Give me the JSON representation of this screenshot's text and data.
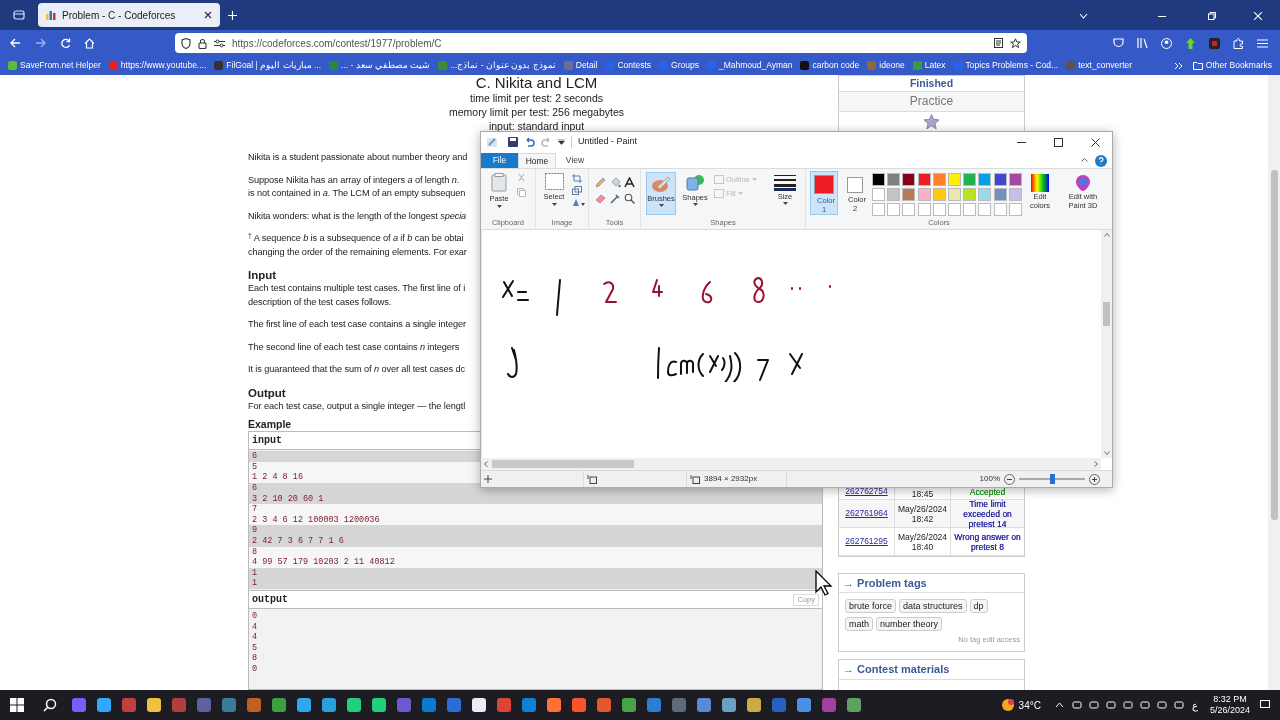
{
  "browser": {
    "tab": {
      "title": "Problem - C - Codeforces",
      "selected": true
    },
    "url": "https://codeforces.com/contest/1977/problem/C",
    "bookmarks": [
      {
        "label": "SaveFrom.net Helper"
      },
      {
        "label": "https://www.youtube...."
      },
      {
        "label": "FilGoal | مباريات اليوم ..."
      },
      {
        "label": "شيت مصطفي سعد - ..."
      },
      {
        "label": "نموذج بدون عنوان - نماذج..."
      },
      {
        "label": "Detail"
      },
      {
        "label": "Contests"
      },
      {
        "label": "Groups"
      },
      {
        "label": "_Mahmoud_Ayman"
      },
      {
        "label": "carbon code"
      },
      {
        "label": "ideone"
      },
      {
        "label": "Latex"
      },
      {
        "label": "Topics Problems - Cod..."
      },
      {
        "label": "text_converter"
      }
    ],
    "other_bookmarks": "Other Bookmarks"
  },
  "problem": {
    "title": "C. Nikita and LCM",
    "limits": [
      "time limit per test: 2 seconds",
      "memory limit per test: 256 megabytes",
      "input: standard input"
    ],
    "blocks": [
      {
        "kind": "text",
        "lines": [
          "Nikita is a student passionate about number theory and"
        ]
      },
      {
        "kind": "text",
        "lines": [
          "Suppose Nikita has an array of integers *a* of length *n*.",
          "is not contained in *a*. The LCM of an empty subsequen"
        ]
      },
      {
        "kind": "text",
        "lines": [
          "Nikita wonders: what is the length of the longest *specia*"
        ]
      },
      {
        "kind": "text",
        "lines": [
          "$^{†}$ A sequence *b* is a subsequence of *a* if *b* can be obtai",
          "changing the order of the remaining elements. For exar"
        ]
      },
      {
        "kind": "heading",
        "text": "Input"
      },
      {
        "kind": "text",
        "lines": [
          "Each test contains multiple test cases. The first line of i",
          "description of the test cases follows."
        ]
      },
      {
        "kind": "text",
        "lines": [
          "The first line of each test case contains a single integer"
        ]
      },
      {
        "kind": "text",
        "lines": [
          "The second line of each test case contains *n* integers"
        ]
      },
      {
        "kind": "text",
        "lines": [
          "It is guaranteed that the sum of *n* over all test cases dc"
        ]
      },
      {
        "kind": "heading",
        "text": "Output"
      },
      {
        "kind": "text",
        "lines": [
          "For each test case, output a single integer — the lengtl"
        ]
      }
    ]
  },
  "example": {
    "title": "Example",
    "input_label": "input",
    "input_lines": [
      {
        "text": "6",
        "highlighted": true
      },
      {
        "text": "5",
        "highlighted": false
      },
      {
        "text": "1 2 4 8 16",
        "highlighted": false
      },
      {
        "text": "6",
        "highlighted": true
      },
      {
        "text": "3 2 10 20 60 1",
        "highlighted": true
      },
      {
        "text": "7",
        "highlighted": false
      },
      {
        "text": "2 3 4 6 12 100003 1200036",
        "highlighted": false
      },
      {
        "text": "9",
        "highlighted": true
      },
      {
        "text": "2 42 7 3 6 7 7 1 6",
        "highlighted": true
      },
      {
        "text": "8",
        "highlighted": false
      },
      {
        "text": "4 99 57 179 10203 2 11 40812",
        "highlighted": false
      },
      {
        "text": "1",
        "highlighted": true
      },
      {
        "text": "1",
        "highlighted": true
      }
    ],
    "output_label": "output",
    "copy": "Copy",
    "output_lines": [
      "0",
      "4",
      "4",
      "5",
      "8",
      "0"
    ]
  },
  "sidebar": {
    "status": "Finished",
    "practice": "Practice",
    "submissions": [
      {
        "id": "262762754",
        "when": "18:45",
        "verdict": "Accepted",
        "color": "#1f9a1f"
      },
      {
        "id": "262761964",
        "when": "May/26/2024 18:42",
        "verdict": "Time limit exceeded on pretest 14",
        "color": "#2a2aa0"
      },
      {
        "id": "262761295",
        "when": "May/26/2024 18:40",
        "verdict": "Wrong answer on pretest 8",
        "color": "#2a2aa0"
      }
    ],
    "tags_title": "→ Problem tags",
    "tags": [
      "brute force",
      "data structures",
      "dp",
      "math",
      "number theory"
    ],
    "tags_note": "No tag edit access",
    "materials_title": "→ Contest materials"
  },
  "paint": {
    "title": "Untitled - Paint",
    "tabs": [
      {
        "label": "File",
        "kind": "file",
        "selected": false
      },
      {
        "label": "Home",
        "kind": "tab",
        "selected": true
      },
      {
        "label": "View",
        "kind": "tab",
        "selected": false
      }
    ],
    "ribbon": {
      "paste": "Paste",
      "select": "Select",
      "brushes": {
        "label": "Brushes",
        "selected": true
      },
      "shapes": "Shapes",
      "outline": {
        "label": "Outline",
        "disabled": true
      },
      "fill": {
        "label": "Fill",
        "disabled": true
      },
      "size": "Size",
      "color1": {
        "label": "Color 1",
        "selected": true,
        "color": "#ed1c24"
      },
      "color2": {
        "label": "Color 2",
        "selected": false,
        "color": "#ffffff"
      },
      "edit_colors": "Edit colors",
      "paint3d": "Edit with Paint 3D",
      "groups": [
        "Clipboard",
        "Image",
        "Tools",
        "Shapes",
        "Colors"
      ]
    },
    "palette": [
      {
        "color": "#000000"
      },
      {
        "color": "#7f7f7f"
      },
      {
        "color": "#880015"
      },
      {
        "color": "#ed1c24"
      },
      {
        "color": "#ff7f27"
      },
      {
        "color": "#fff200"
      },
      {
        "color": "#22b14c"
      },
      {
        "color": "#00a2e8"
      },
      {
        "color": "#3f48cc"
      },
      {
        "color": "#a349a4"
      },
      {
        "color": "#ffffff"
      },
      {
        "color": "#c3c3c3"
      },
      {
        "color": "#b97a57"
      },
      {
        "color": "#ffaec9"
      },
      {
        "color": "#ffc90e"
      },
      {
        "color": "#efe4b0"
      },
      {
        "color": "#b5e61d"
      },
      {
        "color": "#99d9ea"
      },
      {
        "color": "#7092be"
      },
      {
        "color": "#c8bfe7"
      },
      {
        "color": "#ffffff"
      },
      {
        "color": "#ffffff"
      },
      {
        "color": "#ffffff"
      },
      {
        "color": "#ffffff"
      },
      {
        "color": "#ffffff"
      },
      {
        "color": "#ffffff"
      },
      {
        "color": "#ffffff"
      },
      {
        "color": "#ffffff"
      },
      {
        "color": "#ffffff"
      },
      {
        "color": "#ffffff"
      }
    ],
    "dimensions": "3894 × 2932px",
    "zoom": "100%",
    "zoom_slider": {
      "level": 0.5
    }
  },
  "taskbar": {
    "weather": "34°C",
    "language": "ع",
    "time": "8:32 PM",
    "date": "5/26/2024"
  }
}
